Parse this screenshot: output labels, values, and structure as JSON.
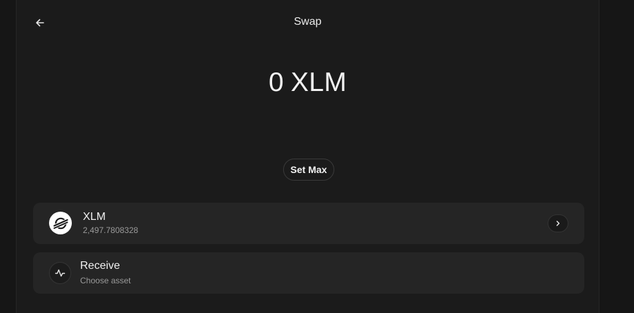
{
  "header": {
    "title": "Swap",
    "back_icon": "arrow-left-icon"
  },
  "amount": {
    "value": "0",
    "unit": "XLM"
  },
  "set_max": {
    "label": "Set Max"
  },
  "from_asset": {
    "code": "XLM",
    "balance": "2,497.7808328",
    "logo_icon": "stellar-logo-icon",
    "action_icon": "chevron-right-icon"
  },
  "receive": {
    "title": "Receive",
    "subtitle": "Choose asset",
    "icon": "activity-pulse-icon"
  },
  "colors": {
    "background": "#161616",
    "panel": "#1b1b1b",
    "card": "#252525",
    "text_primary": "#f0f0f0",
    "text_secondary": "#9a9a9a"
  }
}
